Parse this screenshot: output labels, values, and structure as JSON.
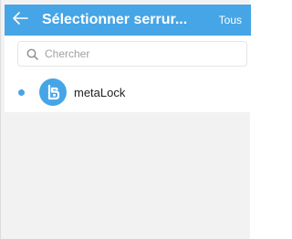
{
  "header": {
    "title": "Sélectionner serrur...",
    "action_label": "Tous",
    "back_icon": "back-arrow-icon"
  },
  "search": {
    "placeholder": "Chercher",
    "value": "",
    "icon": "search-icon"
  },
  "locks": [
    {
      "name": "metaLock",
      "selected": true,
      "icon": "lock-logo-icon"
    }
  ],
  "colors": {
    "accent": "#46a5e6",
    "background": "#f2f2f3",
    "surface": "#ffffff",
    "text": "#222222",
    "placeholder": "#a0a0a0"
  }
}
